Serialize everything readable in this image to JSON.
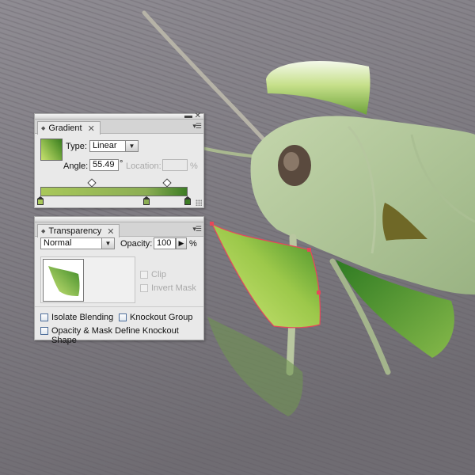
{
  "gradient_panel": {
    "tab_label": "Gradient",
    "type_label": "Type:",
    "type_value": "Linear",
    "angle_label": "Angle:",
    "angle_value": "55.49",
    "angle_unit": "°",
    "location_label": "Location:",
    "location_value": "",
    "location_unit": "%",
    "start_color": "#a7c850",
    "end_color": "#3a7c20",
    "stops": [
      {
        "position": 0.0,
        "color": "#a9c85a"
      },
      {
        "position": 0.72,
        "color": "#8cae54"
      },
      {
        "position": 1.0,
        "color": "#3e7d25"
      }
    ],
    "midpoints": [
      0.35,
      0.86
    ]
  },
  "transparency_panel": {
    "tab_label": "Transparency",
    "blend_mode": "Normal",
    "opacity_label": "Opacity:",
    "opacity_value": "100",
    "opacity_unit": "%",
    "clip_label": "Clip",
    "invert_mask_label": "Invert Mask",
    "isolate_blending_label": "Isolate Blending",
    "knockout_group_label": "Knockout Group",
    "opacity_mask_label": "Opacity & Mask Define Knockout Shape"
  },
  "icons": {
    "close": "close-icon",
    "minimize": "minimize-icon",
    "panel_menu": "panel-menu-icon",
    "dropdown": "chevron-down-icon",
    "stepper": "chevron-right-icon"
  },
  "colors": {
    "leaf_light": "#c9e26f",
    "leaf_dark": "#2f7a1f",
    "selection": "#e6475a"
  }
}
